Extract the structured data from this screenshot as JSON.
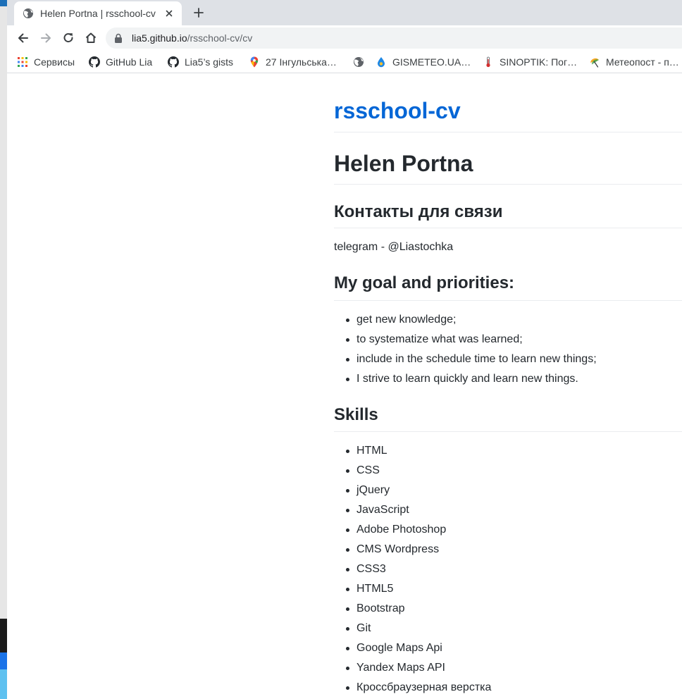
{
  "browser": {
    "tab": {
      "title": "Helen Portna | rsschool-cv"
    },
    "omnibox": {
      "host": "lia5.github.io",
      "path": "/rsschool-cv/cv"
    },
    "bookmarks": [
      {
        "label": "Сервисы",
        "icon": "apps-grid-icon"
      },
      {
        "label": "GitHub Lia",
        "icon": "github-icon"
      },
      {
        "label": "Lia5’s gists",
        "icon": "github-icon"
      },
      {
        "label": "27 Інгульська…",
        "icon": "maps-pin-icon"
      },
      {
        "label": "",
        "icon": "globe-icon"
      },
      {
        "label": "GISMETEO.UA…",
        "icon": "gismeteo-drop-icon"
      },
      {
        "label": "SINOPTIK: Пог…",
        "icon": "thermometer-icon"
      },
      {
        "label": "Метеопост - п…",
        "icon": "umbrella-icon"
      }
    ]
  },
  "page": {
    "site_title": "rsschool-cv",
    "name": "Helen Portna",
    "contacts": {
      "heading": "Контакты для связи",
      "text": "telegram - @Liastochka"
    },
    "goals": {
      "heading": "My goal and priorities:",
      "items": [
        "get new knowledge;",
        "to systematize what was learned;",
        "include in the schedule time to learn new things;",
        "I strive to learn quickly and learn new things."
      ]
    },
    "skills": {
      "heading": "Skills",
      "items": [
        "HTML",
        "CSS",
        "jQuery",
        "JavaScript",
        "Adobe Photoshop",
        "CMS Wordpress",
        "CSS3",
        "HTML5",
        "Bootstrap",
        "Git",
        "Google Maps Api",
        "Yandex Maps API",
        "Кроссбраузерная верстка"
      ]
    }
  }
}
